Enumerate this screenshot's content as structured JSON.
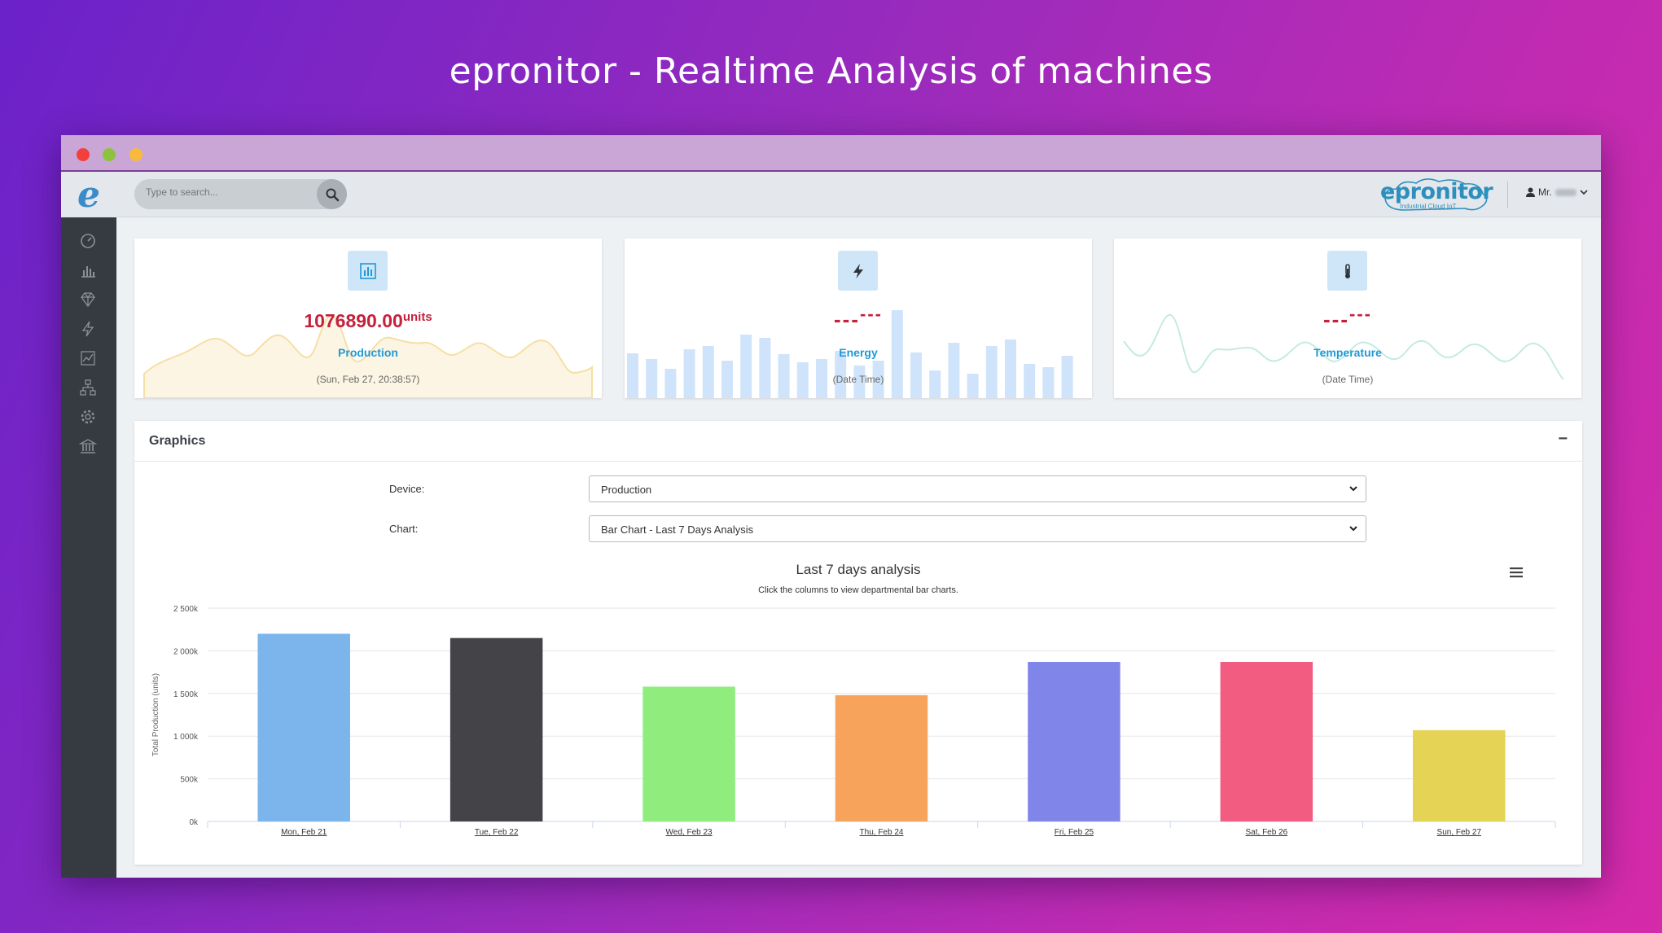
{
  "hero": {
    "title": "epronitor - Realtime Analysis of machines"
  },
  "search": {
    "placeholder": "Type to search..."
  },
  "brand": {
    "name": "epronitor",
    "tagline": "Industrial Cloud IoT"
  },
  "user": {
    "label": "Mr."
  },
  "sidebar": {
    "items": [
      {
        "icon": "dashboard-timer-icon"
      },
      {
        "icon": "bar-chart-icon"
      },
      {
        "icon": "diamond-icon"
      },
      {
        "icon": "lightning-icon"
      },
      {
        "icon": "line-chart-icon"
      },
      {
        "icon": "sitemap-icon"
      },
      {
        "icon": "gear-icon"
      },
      {
        "icon": "bank-icon"
      }
    ]
  },
  "cards": {
    "production": {
      "value": "1076890.00",
      "unit": "units",
      "label": "Production",
      "time": "(Sun, Feb 27, 20:38:57)"
    },
    "energy": {
      "dashes": "---",
      "sup": "---",
      "label": "Energy",
      "time": "(Date Time)"
    },
    "temperature": {
      "dashes": "---",
      "sup": "---",
      "label": "Temperature",
      "time": "(Date Time)"
    }
  },
  "graphics": {
    "title": "Graphics",
    "collapse": "−",
    "device_label": "Device:",
    "device_value": "Production",
    "chart_label": "Chart:",
    "chart_value": "Bar Chart - Last 7 Days Analysis"
  },
  "chart_data": {
    "type": "bar",
    "title": "Last 7 days analysis",
    "subtitle": "Click the columns to view departmental bar charts.",
    "xlabel": "",
    "ylabel": "Total Production (units)",
    "categories": [
      "Mon, Feb 21",
      "Tue, Feb 22",
      "Wed, Feb 23",
      "Thu, Feb 24",
      "Fri, Feb 25",
      "Sat, Feb 26",
      "Sun, Feb 27"
    ],
    "values": [
      2200000,
      2150000,
      1580000,
      1480000,
      1870000,
      1870000,
      1070000
    ],
    "colors": [
      "#7cb5ec",
      "#434348",
      "#90ed7d",
      "#f7a35c",
      "#8085e9",
      "#f15c80",
      "#e4d354"
    ],
    "ylim": [
      0,
      2500000
    ],
    "yticks": [
      "0k",
      "500k",
      "1 000k",
      "1 500k",
      "2 000k",
      "2 500k"
    ],
    "grid": true,
    "legend": "none"
  },
  "colors": {
    "accent": "#1f9ad6",
    "value_red": "#c4213c",
    "sidebar": "#363b41"
  }
}
